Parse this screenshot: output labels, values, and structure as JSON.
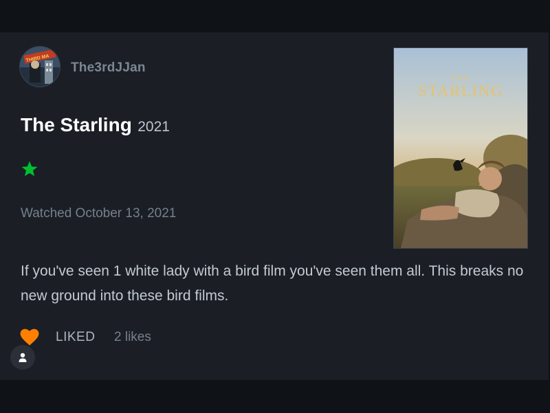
{
  "review": {
    "username": "The3rdJJan",
    "film_title": "The Starling",
    "film_year": "2021",
    "rating_stars": 1,
    "watched_text": "Watched October 13, 2021",
    "body": "If you've seen 1 white lady with a bird film you've seen them all. This breaks no new ground into these bird films.",
    "liked_label": "LIKED",
    "likes_count": "2 likes"
  },
  "poster": {
    "title_small": "THE",
    "title_big": "STARLING"
  },
  "avatar": {
    "badge_text": "THIRD MA"
  },
  "colors": {
    "card_background": "#1b1f25",
    "star_green": "#00c030",
    "heart_orange": "#ff8000",
    "poster_title_gold": "#e6c36a"
  },
  "icons": {
    "rating": "star-icon",
    "like": "heart-icon",
    "profile": "person-icon"
  }
}
